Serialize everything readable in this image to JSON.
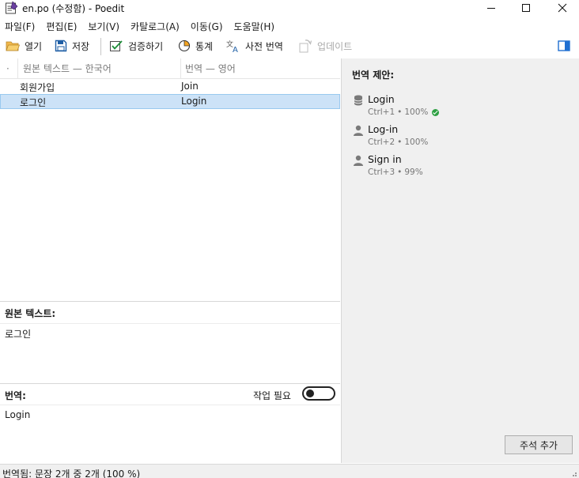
{
  "window": {
    "title": "en.po (수정함) - Poedit"
  },
  "menu": [
    "파일(F)",
    "편집(E)",
    "보기(V)",
    "카탈로그(A)",
    "이동(G)",
    "도움말(H)"
  ],
  "toolbar": {
    "open": "열기",
    "save": "저장",
    "validate": "검증하기",
    "stats": "통계",
    "pretranslate": "사전 번역",
    "update": "업데이트"
  },
  "list": {
    "header_dot": "·",
    "col_source": "원본 텍스트 — 한국어",
    "col_translation": "번역 — 영어",
    "rows": [
      {
        "source": "회원가입",
        "translation": "Join"
      },
      {
        "source": "로그인",
        "translation": "Login"
      }
    ]
  },
  "editor": {
    "source_label": "원본 텍스트:",
    "source_text": "로그인",
    "translation_label": "번역:",
    "needs_work_label": "작업 필요",
    "needs_work_on": false,
    "translation_text": "Login"
  },
  "suggestions": {
    "title": "번역 제안:",
    "items": [
      {
        "text": "Login",
        "shortcut": "Ctrl+1",
        "score": "100%",
        "icon": "database-icon",
        "verified": true
      },
      {
        "text": "Log-in",
        "shortcut": "Ctrl+2",
        "score": "100%",
        "icon": "person-icon",
        "verified": false
      },
      {
        "text": "Sign in",
        "shortcut": "Ctrl+3",
        "score": "99%",
        "icon": "person-icon",
        "verified": false
      }
    ],
    "bullet": "•",
    "add_comment": "주석 추가"
  },
  "status": {
    "text": "번역됨: 문장 2개 중 2개 (100 %)"
  },
  "colors": {
    "selection": "#cce2f7",
    "sidebar_bg": "#f0f0f0",
    "accent": "#0078d7",
    "ok_green": "#2ea043"
  }
}
